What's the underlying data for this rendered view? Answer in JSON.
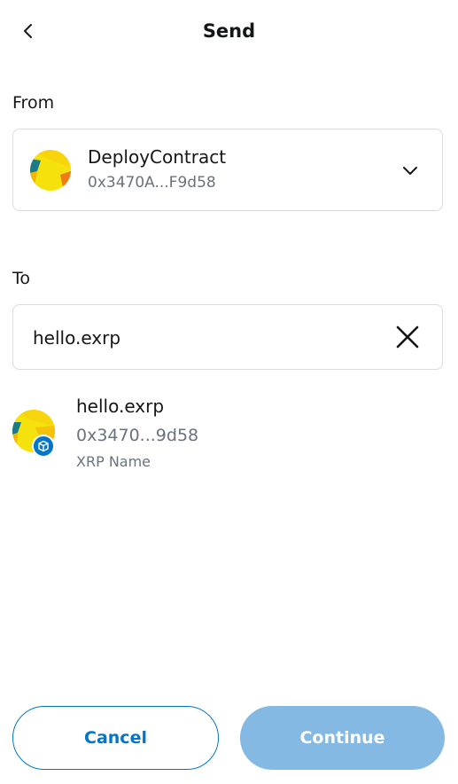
{
  "header": {
    "title": "Send",
    "back_icon": "chevron-left-icon"
  },
  "from": {
    "label": "From",
    "account_name": "DeployContract",
    "account_address": "0x3470A...F9d58",
    "dropdown_icon": "chevron-down-icon"
  },
  "to": {
    "label": "To",
    "input_value": "hello.exrp",
    "clear_icon": "close-icon"
  },
  "suggestion": {
    "name": "hello.exrp",
    "address": "0x3470...9d58",
    "tag": "XRP Name",
    "badge_icon": "cube-icon"
  },
  "actions": {
    "cancel_label": "Cancel",
    "continue_label": "Continue"
  },
  "colors": {
    "accent": "#0376c9",
    "continue_disabled": "#84b9e4",
    "muted_text": "#6a737d",
    "border": "#dadce0"
  }
}
